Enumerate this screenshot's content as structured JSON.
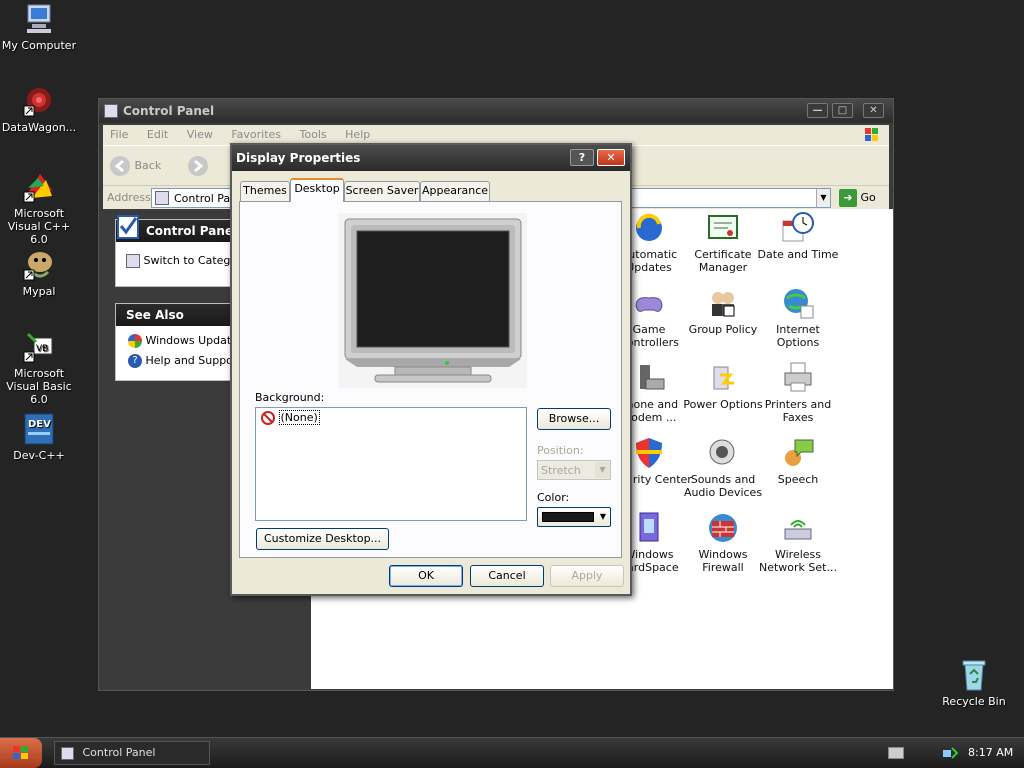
{
  "desktop": {
    "icons": [
      {
        "label": "My Computer",
        "icon": "computer-icon"
      },
      {
        "label": "DataWagon...",
        "icon": "datawagon-icon"
      },
      {
        "label": "Microsoft Visual C++ 6.0",
        "icon": "visual-cpp-icon"
      },
      {
        "label": "Mypal",
        "icon": "mypal-icon"
      },
      {
        "label": "Microsoft Visual Basic 6.0",
        "icon": "visual-basic-icon"
      },
      {
        "label": "Dev-C++",
        "icon": "devcpp-icon"
      },
      {
        "label": "Recycle Bin",
        "icon": "recycle-bin-icon"
      }
    ]
  },
  "control_panel": {
    "title": "Control Panel",
    "menu": [
      "File",
      "Edit",
      "View",
      "Favorites",
      "Tools",
      "Help"
    ],
    "toolbar": {
      "back": "Back"
    },
    "address": {
      "label": "Address",
      "value": "Control Panel",
      "go": "Go"
    },
    "sidebar": {
      "panel_title": "Control Panel",
      "switch_link": "Switch to Category View",
      "see_also_title": "See Also",
      "see_also": [
        "Windows Update",
        "Help and Support"
      ]
    },
    "items": [
      [
        "Automatic Updates",
        "Certificate Manager",
        "Date and Time"
      ],
      [
        "Game Controllers",
        "Group Policy",
        "Internet Options"
      ],
      [
        "Phone and Modem ...",
        "Power Options",
        "Printers and Faxes"
      ],
      [
        "Security Center",
        "Sounds and Audio Devices",
        "Speech"
      ],
      [
        "Windows CardSpace",
        "Windows Firewall",
        "Wireless Network Set..."
      ]
    ]
  },
  "dialog": {
    "title": "Display Properties",
    "tabs": [
      "Themes",
      "Desktop",
      "Screen Saver",
      "Appearance"
    ],
    "active_tab": "Desktop",
    "background_label": "Background:",
    "background_items": [
      "(None)"
    ],
    "browse": "Browse...",
    "position_label": "Position:",
    "position_value": "Stretch",
    "color_label": "Color:",
    "color_value": "#1a1a1a",
    "customize": "Customize Desktop...",
    "ok": "OK",
    "cancel": "Cancel",
    "apply": "Apply"
  },
  "taskbar": {
    "start_icon": "windows-logo-icon",
    "task": "Control Panel",
    "clock": "8:17 AM"
  }
}
